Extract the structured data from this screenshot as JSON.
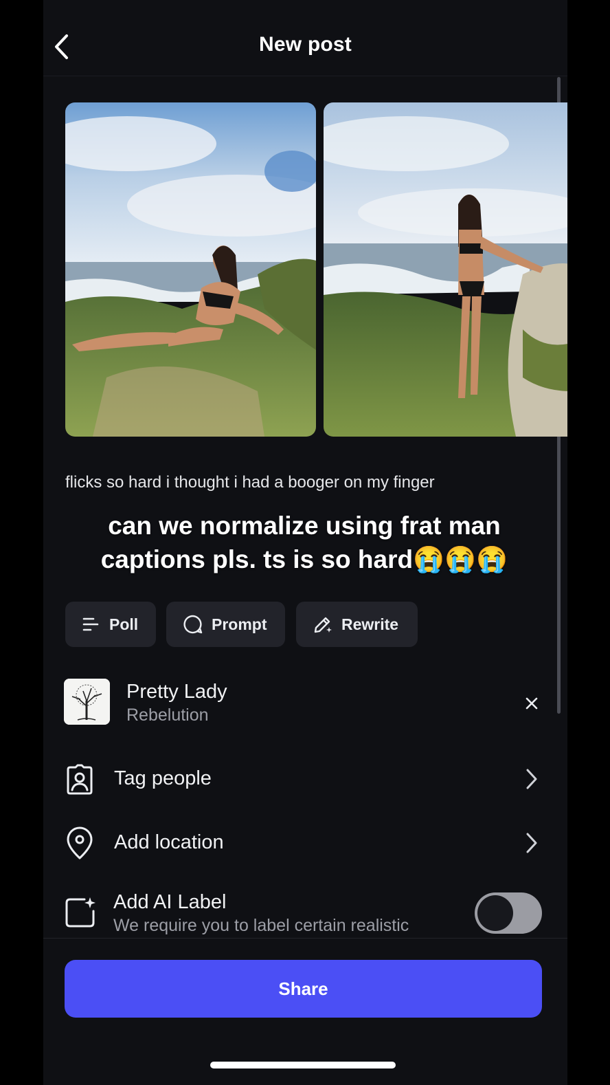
{
  "header": {
    "title": "New post"
  },
  "photos": [
    {
      "alt_icon": "beach-photo-reclining"
    },
    {
      "alt_icon": "beach-photo-standing"
    }
  ],
  "caption": "flicks so hard i thought i had a booger on my finger",
  "overlay_text": "can we normalize using frat man captions pls. ts is so hard😭😭😭",
  "chips": {
    "poll": "Poll",
    "prompt": "Prompt",
    "rewrite": "Rewrite"
  },
  "music": {
    "title": "Pretty Lady",
    "artist": "Rebelution"
  },
  "rows": {
    "tag_people": "Tag people",
    "add_location": "Add location"
  },
  "ai_label": {
    "title": "Add AI Label",
    "subtitle": "We require you to label certain realistic",
    "enabled": false
  },
  "share_label": "Share",
  "colors": {
    "background": "#0f1014",
    "chip": "#22232a",
    "accent": "#4b4ff5"
  }
}
